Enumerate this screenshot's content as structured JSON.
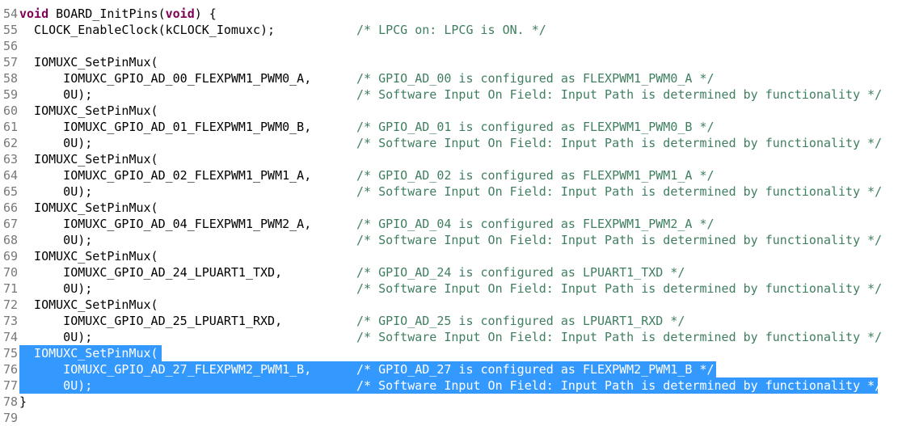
{
  "editor": {
    "selection_color": "#3399ff",
    "comment_color": "#3f7f5f",
    "keyword_color": "#7f0055",
    "lines": [
      {
        "num": "54",
        "kw1": "void",
        "code": " BOARD_InitPins(",
        "kw2": "void",
        "code2": ") {",
        "comment": ""
      },
      {
        "num": "55",
        "code": "  CLOCK_EnableClock(kCLOCK_Iomuxc);",
        "comment": "/* LPCG on: LPCG is ON. */"
      },
      {
        "num": "56",
        "code": "",
        "comment": ""
      },
      {
        "num": "57",
        "code": "  IOMUXC_SetPinMux(",
        "comment": ""
      },
      {
        "num": "58",
        "code": "      IOMUXC_GPIO_AD_00_FLEXPWM1_PWM0_A,",
        "comment": "/* GPIO_AD_00 is configured as FLEXPWM1_PWM0_A */"
      },
      {
        "num": "59",
        "code": "      0U);",
        "comment": "/* Software Input On Field: Input Path is determined by functionality */"
      },
      {
        "num": "60",
        "code": "  IOMUXC_SetPinMux(",
        "comment": ""
      },
      {
        "num": "61",
        "code": "      IOMUXC_GPIO_AD_01_FLEXPWM1_PWM0_B,",
        "comment": "/* GPIO_AD_01 is configured as FLEXPWM1_PWM0_B */"
      },
      {
        "num": "62",
        "code": "      0U);",
        "comment": "/* Software Input On Field: Input Path is determined by functionality */"
      },
      {
        "num": "63",
        "code": "  IOMUXC_SetPinMux(",
        "comment": ""
      },
      {
        "num": "64",
        "code": "      IOMUXC_GPIO_AD_02_FLEXPWM1_PWM1_A,",
        "comment": "/* GPIO_AD_02 is configured as FLEXPWM1_PWM1_A */"
      },
      {
        "num": "65",
        "code": "      0U);",
        "comment": "/* Software Input On Field: Input Path is determined by functionality */"
      },
      {
        "num": "66",
        "code": "  IOMUXC_SetPinMux(",
        "comment": ""
      },
      {
        "num": "67",
        "code": "      IOMUXC_GPIO_AD_04_FLEXPWM1_PWM2_A,",
        "comment": "/* GPIO_AD_04 is configured as FLEXPWM1_PWM2_A */"
      },
      {
        "num": "68",
        "code": "      0U);",
        "comment": "/* Software Input On Field: Input Path is determined by functionality */"
      },
      {
        "num": "69",
        "code": "  IOMUXC_SetPinMux(",
        "comment": ""
      },
      {
        "num": "70",
        "code": "      IOMUXC_GPIO_AD_24_LPUART1_TXD,",
        "comment": "/* GPIO_AD_24 is configured as LPUART1_TXD */"
      },
      {
        "num": "71",
        "code": "      0U);",
        "comment": "/* Software Input On Field: Input Path is determined by functionality */"
      },
      {
        "num": "72",
        "code": "  IOMUXC_SetPinMux(",
        "comment": ""
      },
      {
        "num": "73",
        "code": "      IOMUXC_GPIO_AD_25_LPUART1_RXD,",
        "comment": "/* GPIO_AD_25 is configured as LPUART1_RXD */"
      },
      {
        "num": "74",
        "code": "      0U);",
        "comment": "/* Software Input On Field: Input Path is determined by functionality */"
      },
      {
        "num": "75",
        "code": "  IOMUXC_SetPinMux(",
        "comment": "",
        "selected": true
      },
      {
        "num": "76",
        "code": "      IOMUXC_GPIO_AD_27_FLEXPWM2_PWM1_B,",
        "comment": "/* GPIO_AD_27 is configured as FLEXPWM2_PWM1_B */",
        "selected": true
      },
      {
        "num": "77",
        "code": "      0U);",
        "comment": "/* Software Input On Field: Input Path is determined by functionality */",
        "selected": true
      },
      {
        "num": "78",
        "code": "}",
        "comment": ""
      },
      {
        "num": "79",
        "code": "",
        "comment": ""
      }
    ]
  }
}
